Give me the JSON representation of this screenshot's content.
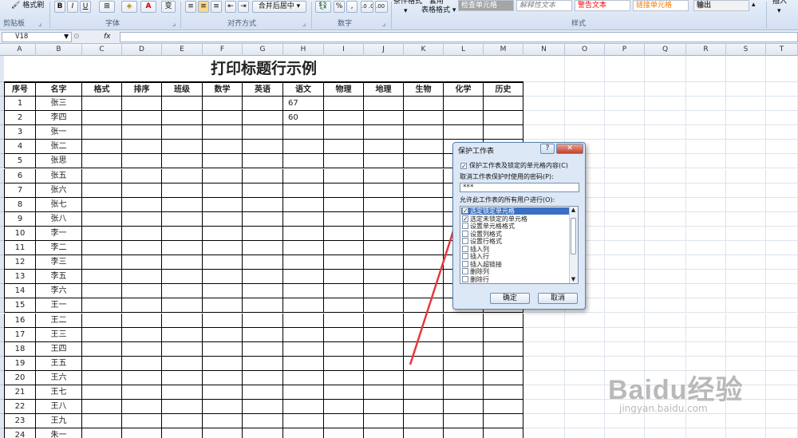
{
  "ribbon": {
    "format_painter": "格式刷",
    "bold": "B",
    "italic": "I",
    "underline": "U",
    "font_color": "A",
    "wen": "变",
    "merge_center": "合并后居中",
    "percent": "%",
    "comma": ",",
    "dec_inc": ".0 .00",
    "dec_dec": ".00 .0",
    "cond_format": "条件格式",
    "apply_label": "套用",
    "table_format": "表格格式",
    "style_cells": [
      "检查单元格",
      "解释性文本",
      "警告文本",
      "链接单元格",
      "输出"
    ],
    "insert": "插入",
    "groups": [
      "剪贴板",
      "字体",
      "对齐方式",
      "数字",
      "样式"
    ]
  },
  "formula_bar": {
    "name_box": "V18",
    "fx": "fx",
    "content": ""
  },
  "columns": [
    "A",
    "B",
    "C",
    "D",
    "E",
    "F",
    "G",
    "H",
    "I",
    "J",
    "K",
    "L",
    "M",
    "N",
    "O",
    "P",
    "Q",
    "R",
    "S",
    "T"
  ],
  "sheet": {
    "title": "打印标题行示例",
    "headers": [
      "序号",
      "名字",
      "格式",
      "排序",
      "班级",
      "数学",
      "英语",
      "语文",
      "物理",
      "地理",
      "生物",
      "化学",
      "历史"
    ],
    "rows": [
      {
        "no": "1",
        "name": "张三",
        "chinese": "67"
      },
      {
        "no": "2",
        "name": "李四",
        "chinese": "60"
      },
      {
        "no": "3",
        "name": "张一",
        "chinese": ""
      },
      {
        "no": "4",
        "name": "张二",
        "chinese": ""
      },
      {
        "no": "5",
        "name": "张思",
        "chinese": ""
      },
      {
        "no": "6",
        "name": "张五",
        "chinese": ""
      },
      {
        "no": "7",
        "name": "张六",
        "chinese": ""
      },
      {
        "no": "8",
        "name": "张七",
        "chinese": ""
      },
      {
        "no": "9",
        "name": "张八",
        "chinese": ""
      },
      {
        "no": "10",
        "name": "李一",
        "chinese": ""
      },
      {
        "no": "11",
        "name": "李二",
        "chinese": ""
      },
      {
        "no": "12",
        "name": "李三",
        "chinese": ""
      },
      {
        "no": "13",
        "name": "李五",
        "chinese": ""
      },
      {
        "no": "14",
        "name": "李六",
        "chinese": ""
      },
      {
        "no": "15",
        "name": "王一",
        "chinese": ""
      },
      {
        "no": "16",
        "name": "王二",
        "chinese": ""
      },
      {
        "no": "17",
        "name": "王三",
        "chinese": ""
      },
      {
        "no": "18",
        "name": "王四",
        "chinese": ""
      },
      {
        "no": "19",
        "name": "王五",
        "chinese": ""
      },
      {
        "no": "20",
        "name": "王六",
        "chinese": ""
      },
      {
        "no": "21",
        "name": "王七",
        "chinese": ""
      },
      {
        "no": "22",
        "name": "王八",
        "chinese": ""
      },
      {
        "no": "23",
        "name": "王九",
        "chinese": ""
      },
      {
        "no": "24",
        "name": "朱一",
        "chinese": ""
      }
    ]
  },
  "dialog": {
    "title": "保护工作表",
    "help": "?",
    "close": "✕",
    "protect_label": "保护工作表及锁定的单元格内容(C)",
    "password_label": "取消工作表保护时使用的密码(P):",
    "password_value": "***",
    "allow_label": "允许此工作表的所有用户进行(O):",
    "permissions": [
      {
        "label": "选定锁定单元格",
        "checked": true
      },
      {
        "label": "选定未锁定的单元格",
        "checked": true
      },
      {
        "label": "设置单元格格式",
        "checked": false
      },
      {
        "label": "设置列格式",
        "checked": false
      },
      {
        "label": "设置行格式",
        "checked": false
      },
      {
        "label": "插入列",
        "checked": false
      },
      {
        "label": "插入行",
        "checked": false
      },
      {
        "label": "插入超链接",
        "checked": false
      },
      {
        "label": "删除列",
        "checked": false
      },
      {
        "label": "删除行",
        "checked": false
      }
    ],
    "ok": "确定",
    "cancel": "取消"
  },
  "watermark": {
    "brand": "Baidu经验",
    "url": "jingyan.baidu.com"
  },
  "colors": {
    "arrow": "#e8383d",
    "ribbon_bg": "#dce6f4",
    "selection": "#3a6fc4"
  }
}
